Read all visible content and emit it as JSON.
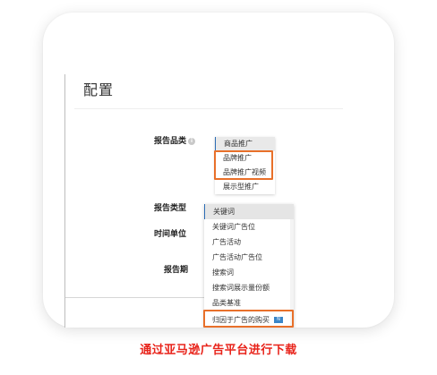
{
  "page": {
    "title": "配置"
  },
  "fields": {
    "report_category_label": "报告品类",
    "report_type_label": "报告类型",
    "time_unit_label": "时间单位",
    "report_period_label": "报告期"
  },
  "category_options": [
    "商品推广",
    "品牌推广",
    "品牌推广视频",
    "展示型推广"
  ],
  "type_options": [
    "关键词",
    "关键词广告位",
    "广告活动",
    "广告活动广告位",
    "搜索词",
    "搜索词展示量份额",
    "品类基准",
    "归因于广告的购买"
  ],
  "highlight_color": "#e8702a",
  "accent_color": "#2d6db5",
  "caption": "通过亚马逊广告平台进行下载"
}
